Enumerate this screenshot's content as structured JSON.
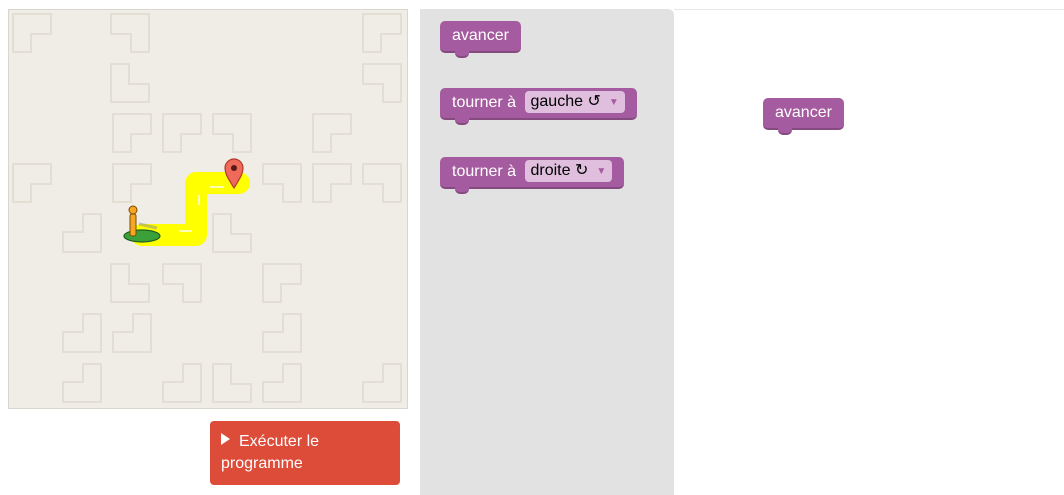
{
  "maze": {
    "background": "#f0ede6",
    "path_color": "#ffff00",
    "marker_color": "#ee6a5a"
  },
  "run_button": {
    "label": "Exécuter le programme",
    "icon": "play-icon"
  },
  "toolbox": {
    "blocks": [
      {
        "label": "avancer"
      },
      {
        "label": "tourner à",
        "option": "gauche ↺"
      },
      {
        "label": "tourner à",
        "option": "droite ↻"
      }
    ]
  },
  "workspace": {
    "blocks": [
      {
        "label": "avancer"
      }
    ]
  },
  "colors": {
    "block": "#a55b9f",
    "run_button": "#dd4b39",
    "toolbox": "#e2e2e2"
  }
}
